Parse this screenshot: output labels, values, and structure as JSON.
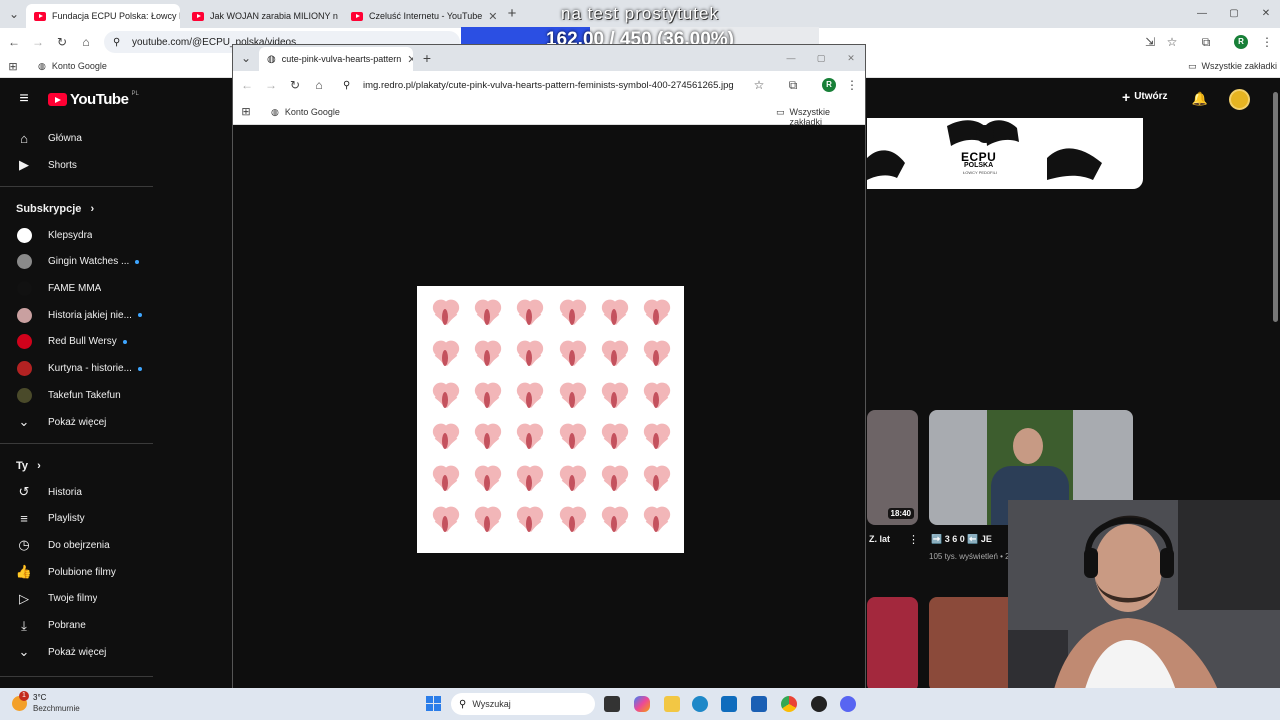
{
  "browser": {
    "tabs": [
      {
        "label": "Fundacja ECPU Polska: Łowcy P",
        "active": true
      },
      {
        "label": "Jak WOJAN zarabia MILIONY n",
        "active": false
      },
      {
        "label": "Czeluść Internetu - YouTube",
        "active": false
      }
    ],
    "new_tab": "+",
    "url": "youtube.com/@ECPU_polska/videos",
    "bookmark_item": "Konto Google",
    "all_bookmarks": "Wszystkie zakładki",
    "profile_initial": "R",
    "window_controls": {
      "minimize": "—",
      "maximize": "▢",
      "close": "✕"
    }
  },
  "overlay": {
    "title": "na test prostytutek",
    "progress_text": "162.00 / 450 (36.00%)",
    "progress_fraction": 0.36,
    "progress_color": "#2b4fe3"
  },
  "popup": {
    "tab_label": "cute-pink-vulva-hearts-pattern",
    "url": "img.redro.pl/plakaty/cute-pink-vulva-hearts-pattern-feminists-symbol-400-274561265.jpg",
    "bookmark_item": "Konto Google",
    "all_bookmarks": "Wszystkie zakładki",
    "profile_initial": "R"
  },
  "youtube": {
    "logo": "YouTube",
    "logo_region": "PL",
    "create_label": "Utwórz",
    "main_nav": [
      {
        "label": "Główna",
        "icon": "home-icon",
        "glyph": "⌂"
      },
      {
        "label": "Shorts",
        "icon": "shorts-icon",
        "glyph": "▶"
      }
    ],
    "subscriptions_heading": "Subskrypcje",
    "subscriptions": [
      {
        "label": "Klepsydra",
        "dot": false,
        "color": "#ffffff"
      },
      {
        "label": "Gingin Watches ...",
        "dot": true,
        "color": "#8a8a8a"
      },
      {
        "label": "FAME MMA",
        "dot": false,
        "color": "#111111"
      },
      {
        "label": "Historia jakiej nie...",
        "dot": true,
        "color": "#c9a0a0"
      },
      {
        "label": "Red Bull Wersy",
        "dot": true,
        "color": "#d0021b"
      },
      {
        "label": "Kurtyna - historie...",
        "dot": true,
        "color": "#b22222"
      },
      {
        "label": "Takefun Takefun",
        "dot": false,
        "color": "#4a4a2a"
      }
    ],
    "show_more_1": "Pokaż więcej",
    "you_heading": "Ty",
    "you_items": [
      {
        "label": "Historia",
        "icon": "history-icon",
        "glyph": "↺"
      },
      {
        "label": "Playlisty",
        "icon": "playlist-icon",
        "glyph": "≡"
      },
      {
        "label": "Do obejrzenia",
        "icon": "watch-later-icon",
        "glyph": "◷"
      },
      {
        "label": "Polubione filmy",
        "icon": "like-icon",
        "glyph": "👍"
      },
      {
        "label": "Twoje filmy",
        "icon": "your-videos-icon",
        "glyph": "▷"
      },
      {
        "label": "Pobrane",
        "icon": "download-icon",
        "glyph": "⤓"
      }
    ],
    "show_more_2": "Pokaż więcej",
    "banner": {
      "brand": "ECPU",
      "brand_sub": "POLSKA",
      "tagline": "ŁOWCY PEDOFILI"
    },
    "videos": [
      {
        "duration": "18:40",
        "title_fragment": "Z. lat",
        "views": ""
      },
      {
        "duration": "",
        "title_fragment": "➡️ 3 6 0 ⬅️ JE",
        "views": "105 tys. wyświetleń • 2"
      }
    ]
  },
  "taskbar": {
    "weather_temp": "3°C",
    "weather_desc": "Bezchmurnie",
    "weather_badge": "1",
    "search_placeholder": "Wyszukaj"
  }
}
